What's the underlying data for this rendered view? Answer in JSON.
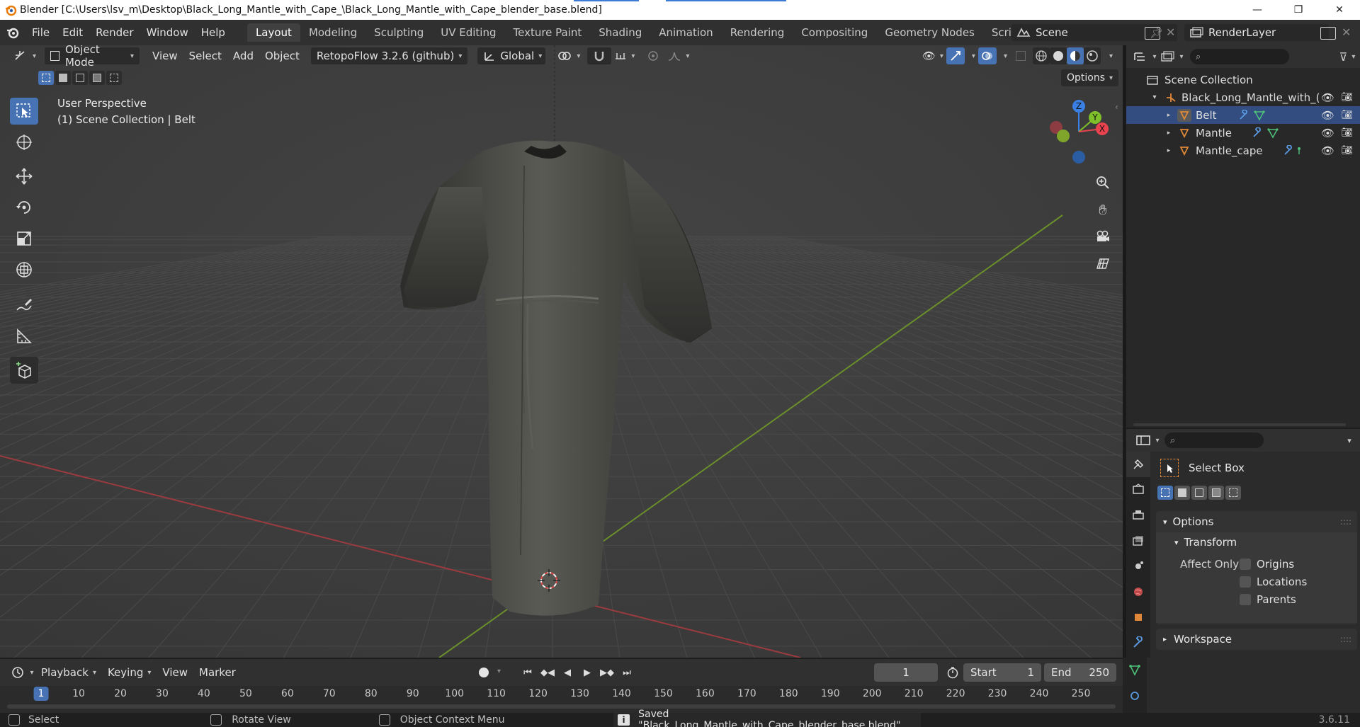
{
  "window": {
    "title": "Blender [C:\\Users\\lsv_m\\Desktop\\Black_Long_Mantle_with_Cape_\\Black_Long_Mantle_with_Cape_blender_base.blend]",
    "minimize": "—",
    "maximize": "❐",
    "close": "✕"
  },
  "menu": [
    "File",
    "Edit",
    "Render",
    "Window",
    "Help"
  ],
  "workspaces": [
    "Layout",
    "Modeling",
    "Sculpting",
    "UV Editing",
    "Texture Paint",
    "Shading",
    "Animation",
    "Rendering",
    "Compositing",
    "Geometry Nodes",
    "Scripting",
    "+"
  ],
  "scene": {
    "name": "Scene",
    "view_layer": "RenderLayer"
  },
  "viewport": {
    "mode": "Object Mode",
    "menus": [
      "View",
      "Select",
      "Add",
      "Object"
    ],
    "addon": "RetopoFlow 3.2.6 (github)",
    "orientation": "Global",
    "options_label": "Options",
    "perspective_label": "User Perspective",
    "collection_label": "(1) Scene Collection | Belt",
    "gizmo_axes": {
      "z": "Z",
      "y": "Y",
      "x": "X"
    }
  },
  "outliner": {
    "root": "Scene Collection",
    "collection": "Black_Long_Mantle_with_(",
    "objects": [
      "Belt",
      "Mantle",
      "Mantle_cape"
    ]
  },
  "properties": {
    "tool_name": "Select Box",
    "options_panel": "Options",
    "transform_panel": "Transform",
    "affect_only_label": "Affect Only",
    "checkboxes": [
      "Origins",
      "Locations",
      "Parents"
    ],
    "workspace_panel": "Workspace"
  },
  "timeline": {
    "menus": [
      "Playback",
      "Keying",
      "View",
      "Marker"
    ],
    "current_frame": "1",
    "start_label": "Start",
    "start_value": "1",
    "end_label": "End",
    "end_value": "250",
    "ticks": [
      "1",
      "10",
      "20",
      "30",
      "40",
      "50",
      "60",
      "70",
      "80",
      "90",
      "100",
      "110",
      "120",
      "130",
      "140",
      "150",
      "160",
      "170",
      "180",
      "190",
      "200",
      "210",
      "220",
      "230",
      "240",
      "250"
    ]
  },
  "status": {
    "select": "Select",
    "rotate": "Rotate View",
    "context": "Object Context Menu",
    "message": "Saved \"Black_Long_Mantle_with_Cape_blender_base.blend\"",
    "version": "3.6.11"
  },
  "colors": {
    "accent": "#4772b3",
    "object_orange": "#e0883a",
    "modifier_blue": "#5a9ae0",
    "mesh_green": "#4fc27a",
    "axis_x": "#e8434f",
    "axis_y": "#7fbf2a",
    "axis_z": "#3a80e4"
  }
}
